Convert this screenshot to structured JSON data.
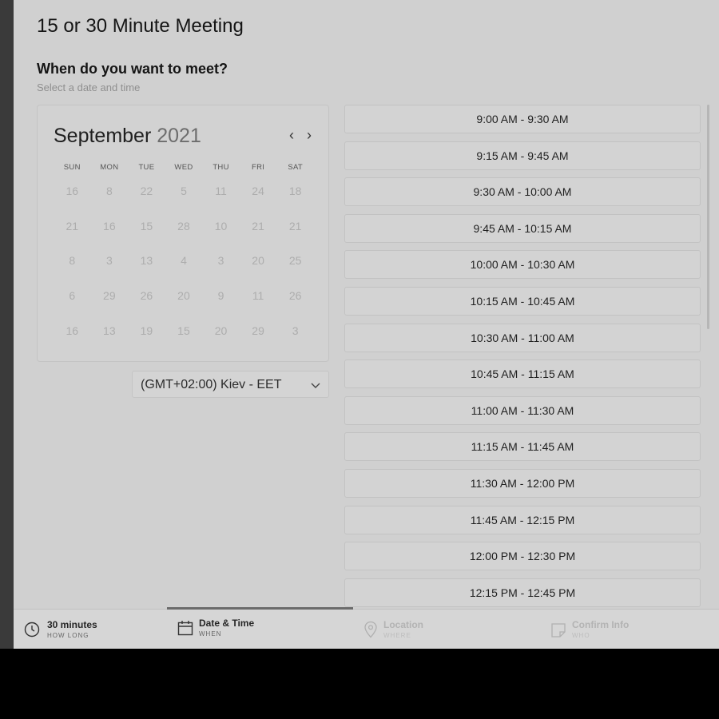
{
  "page": {
    "title": "15 or 30 Minute Meeting",
    "question": "When do you want to meet?",
    "hint": "Select a date and time"
  },
  "calendar": {
    "month": "September",
    "year": "2021",
    "days_of_week": [
      "SUN",
      "MON",
      "TUE",
      "WED",
      "THU",
      "FRI",
      "SAT"
    ],
    "weeks": [
      [
        "16",
        "8",
        "22",
        "5",
        "11",
        "24",
        "18"
      ],
      [
        "21",
        "16",
        "15",
        "28",
        "10",
        "21",
        "21"
      ],
      [
        "8",
        "3",
        "13",
        "4",
        "3",
        "20",
        "25"
      ],
      [
        "6",
        "29",
        "26",
        "20",
        "9",
        "11",
        "26"
      ],
      [
        "16",
        "13",
        "19",
        "15",
        "20",
        "29",
        "3"
      ]
    ]
  },
  "timezone": {
    "label": "(GMT+02:00) Kiev - EET"
  },
  "slots": [
    "9:00 AM - 9:30 AM",
    "9:15 AM - 9:45 AM",
    "9:30 AM - 10:00 AM",
    "9:45 AM - 10:15 AM",
    "10:00 AM - 10:30 AM",
    "10:15 AM - 10:45 AM",
    "10:30 AM - 11:00 AM",
    "10:45 AM - 11:15 AM",
    "11:00 AM - 11:30 AM",
    "11:15 AM - 11:45 AM",
    "11:30 AM - 12:00 PM",
    "11:45 AM - 12:15 PM",
    "12:00 PM - 12:30 PM",
    "12:15 PM - 12:45 PM"
  ],
  "footer": {
    "steps": [
      {
        "label": "30 minutes",
        "sub": "HOW LONG",
        "icon": "clock-icon"
      },
      {
        "label": "Date & Time",
        "sub": "WHEN",
        "icon": "calendar-icon"
      },
      {
        "label": "Location",
        "sub": "WHERE",
        "icon": "location-pin-icon"
      },
      {
        "label": "Confirm Info",
        "sub": "WHO",
        "icon": "note-icon"
      }
    ]
  }
}
